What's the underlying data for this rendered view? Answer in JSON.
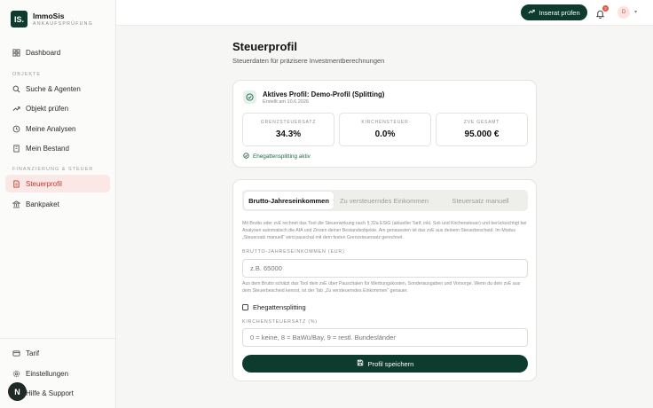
{
  "brand": {
    "name": "ImmoSis",
    "subtitle": "ANKAUFSPRÜFUNG",
    "logo_text": "IS."
  },
  "sidebar": {
    "dashboard": "Dashboard",
    "section_objekte": "OBJEKTE",
    "suche": "Suche & Agenten",
    "objekt_pruefen": "Objekt prüfen",
    "analysen": "Meine Analysen",
    "bestand": "Mein Bestand",
    "section_finanzierung": "FINANZIERUNG & STEUER",
    "steuerprofil": "Steuerprofil",
    "bankpaket": "Bankpaket",
    "tarif": "Tarif",
    "einstellungen": "Einstellungen",
    "hilfe": "Hilfe & Support",
    "fab_letter": "N"
  },
  "topbar": {
    "cta": "Inserat prüfen",
    "notification_count": "2",
    "avatar_initial": "D"
  },
  "page": {
    "title": "Steuerprofil",
    "subtitle": "Steuerdaten für präzisere Investmentberechnungen"
  },
  "profile": {
    "title": "Aktives Profil: Demo-Profil (Splitting)",
    "created": "Erstellt am 10.6.2026",
    "stats": [
      {
        "label": "GRENZSTEUERSATZ",
        "value": "34.3%"
      },
      {
        "label": "KIRCHENSTEUER",
        "value": "0.0%"
      },
      {
        "label": "ZVE GESAMT",
        "value": "95.000 €"
      }
    ],
    "splitting_status": "Ehegattensplitting aktiv"
  },
  "form": {
    "tabs": [
      "Brutto-Jahreseinkommen",
      "Zu versteuerndes Einkommen",
      "Steuersatz manuell"
    ],
    "intro": "Mit Brutto oder zvE rechnet das Tool die Steuerwirkung nach § 32a EStG (aktueller Tarif, inkl. Soli und Kirchensteuer) und berücksichtigt bei Analysen automatisch die AfA und Zinsen deiner Bestandsobjekte. Am genauesten ist das zvE aus deinem Steuerbescheid. Im Modus „Steuersatz manuell“ wird pauschal mit dem festen Grenzsteuersatz gerechnet.",
    "brutto_label": "BRUTTO-JAHRESEINKOMMEN (EUR)",
    "brutto_placeholder": "z.B. 65000",
    "brutto_help": "Aus dem Brutto schätzt das Tool dein zvE über Pauschalen für Werbungskosten, Sonderausgaben und Vorsorge. Wenn du dein zvE aus dem Steuerbescheid kennst, ist der Tab „Zu versteuerndes Einkommen“ genauer.",
    "splitting_label": "Ehegattensplitting",
    "kirche_label": "KIRCHENSTEUERSATZ (%)",
    "kirche_placeholder": "0 = keine, 8 = BaWü/Bay, 9 = restl. Bundesländer",
    "save": "Profil speichern"
  },
  "colors": {
    "brand_green": "#0d3b2e",
    "active_red": "#c0392b",
    "active_bg": "#fbe8e6",
    "success_green": "#1d6b46"
  }
}
